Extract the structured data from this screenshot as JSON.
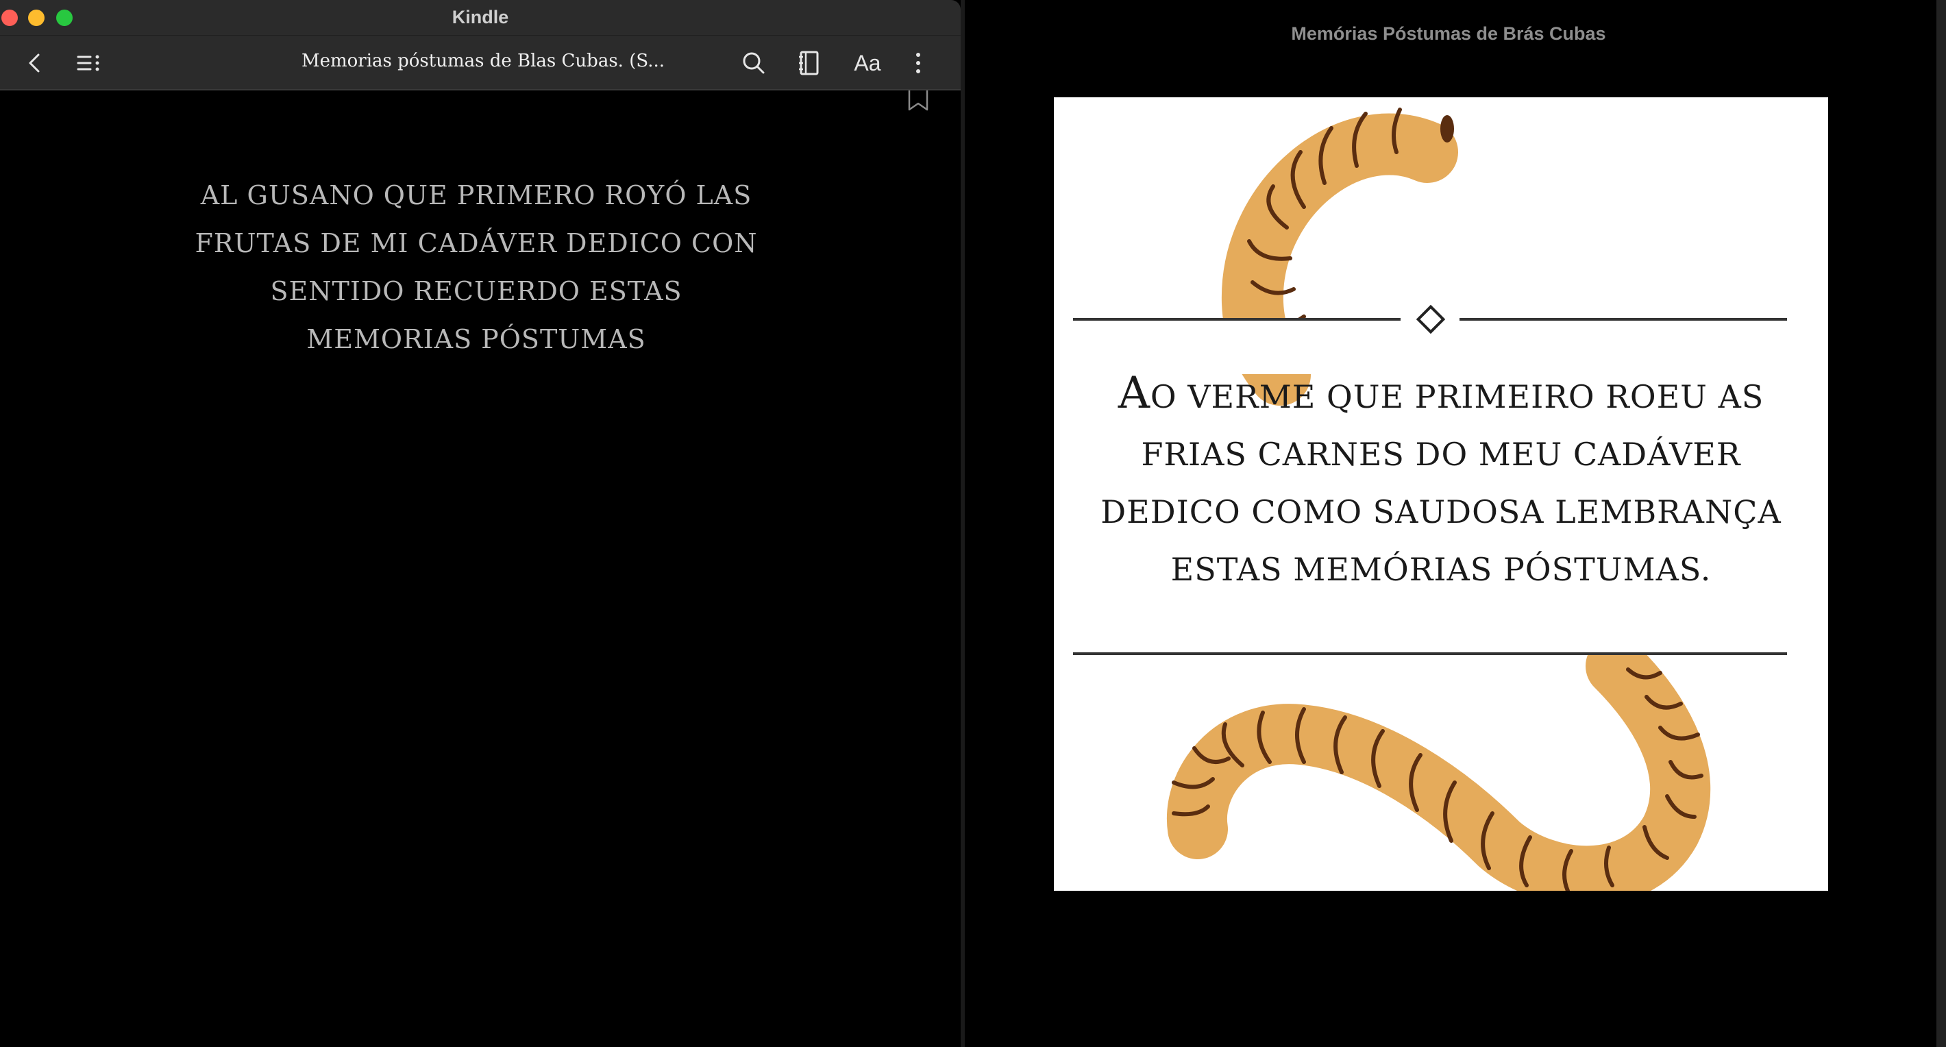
{
  "kindle": {
    "window_title": "Kindle",
    "book_title": "Memorias póstumas de Blas Cubas. (S...",
    "font_button_label": "Aa",
    "dedication": "AL GUSANO QUE PRIMERO ROYÓ LAS FRUTAS DE MI CADÁVER DEDICO CON SENTIDO RECUERDO ESTAS MEMORIAS PÓSTUMAS",
    "icons": [
      "back-icon",
      "table-of-contents-icon",
      "search-icon",
      "notebook-icon",
      "more-icon",
      "bookmark-icon"
    ]
  },
  "preview": {
    "window_title": "Memórias Póstumas de Brás Cubas",
    "dedication_initial": "A",
    "dedication_rest": "O VERME QUE PRIMEIRO ROEU AS FRIAS CARNES DO MEU CADÁVER DEDICO COMO SAUDOSA LEMBRANÇA ESTAS MEMÓRIAS PÓSTUMAS."
  },
  "colors": {
    "worm_body": "#e5ab5b",
    "worm_stripes": "#5a2d10",
    "toolbar_bg": "#2b2b2b"
  }
}
